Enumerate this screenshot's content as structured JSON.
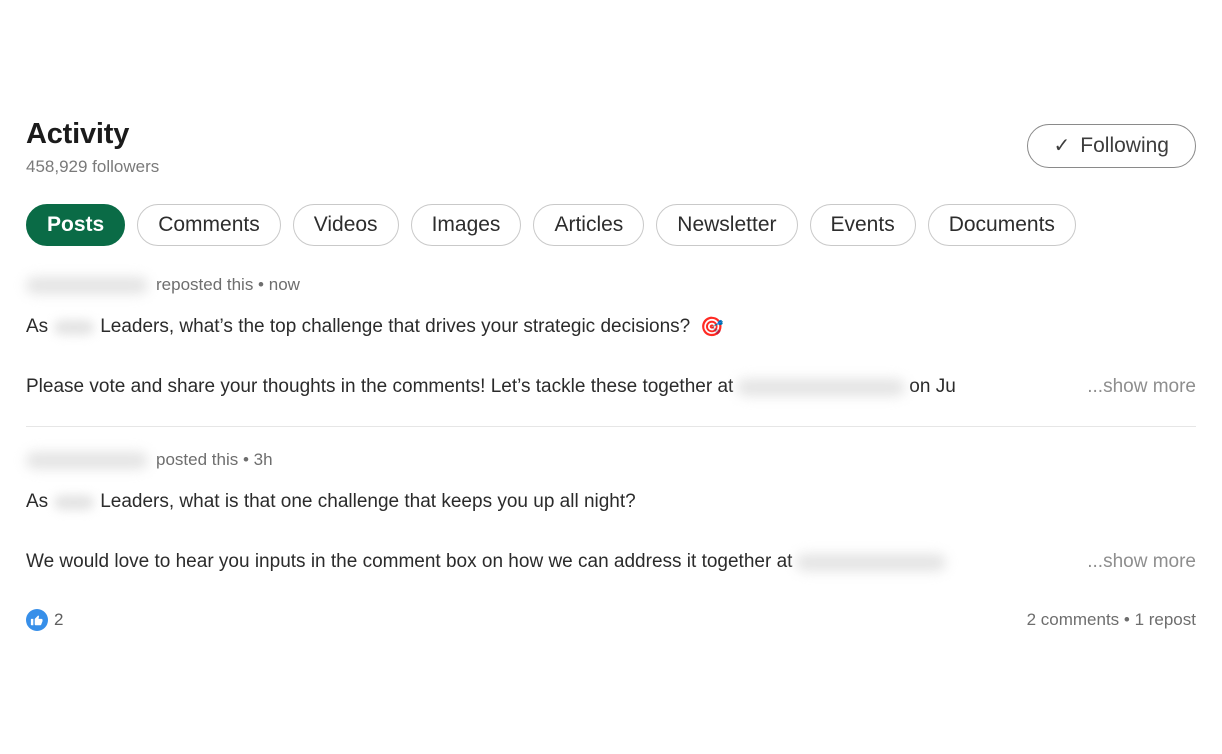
{
  "header": {
    "title": "Activity",
    "followers": "458,929 followers",
    "follow_button": {
      "label": "Following",
      "icon": "check-icon",
      "glyph": "✓",
      "state": "following"
    }
  },
  "tabs": [
    {
      "label": "Posts",
      "active": true
    },
    {
      "label": "Comments",
      "active": false
    },
    {
      "label": "Videos",
      "active": false
    },
    {
      "label": "Images",
      "active": false
    },
    {
      "label": "Articles",
      "active": false
    },
    {
      "label": "Newsletter",
      "active": false
    },
    {
      "label": "Events",
      "active": false
    },
    {
      "label": "Documents",
      "active": false
    }
  ],
  "feed": {
    "posts": [
      {
        "meta": {
          "author_redacted": true,
          "action": "reposted this",
          "separator": "•",
          "timestamp": "now",
          "text": "reposted this • now"
        },
        "line_1": {
          "before": "As",
          "redacted_word": true,
          "after": "Leaders, what’s the top challenge that drives your strategic decisions?",
          "emoji": "🎯"
        },
        "line_2": {
          "before": "Please vote and share your thoughts in the comments! Let’s tackle these together at",
          "redacted_span": true,
          "after": "on Ju",
          "show_more": "...show more"
        }
      },
      {
        "meta": {
          "author_redacted": true,
          "action": "posted this",
          "separator": "•",
          "timestamp": "3h",
          "text": "posted this • 3h"
        },
        "line_1": {
          "before": "As",
          "redacted_word": true,
          "after": "Leaders, what is that one challenge that keeps you up all night?",
          "emoji": ""
        },
        "line_2": {
          "before": "We would love to hear you inputs in the comment box on how we can address it together at",
          "redacted_span": true,
          "after": "",
          "show_more": "...show more"
        }
      }
    ]
  },
  "social": {
    "reaction_icon": "like-thumbs-up-icon",
    "reaction_count": "2",
    "engagement": "2 comments • 1 repost"
  },
  "colors": {
    "active_tab_green": "#0a6b46",
    "like_blue": "#378fe9",
    "muted_text": "#6e6e6e",
    "body_text": "#2b2b2b",
    "border": "#c9c9c9"
  }
}
